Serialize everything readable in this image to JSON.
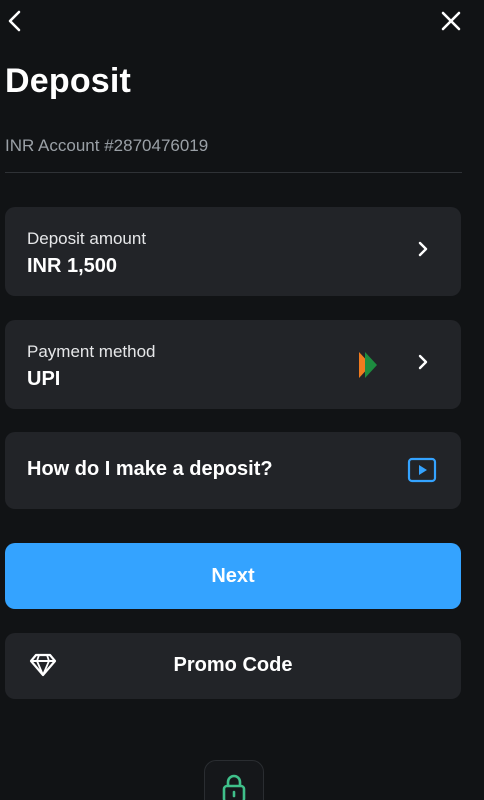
{
  "header": {
    "title": "Deposit",
    "back_icon": "back-arrow-icon",
    "close_icon": "close-icon"
  },
  "account": {
    "label": "INR Account #2870476019"
  },
  "deposit_amount": {
    "label": "Deposit amount",
    "value": "INR 1,500"
  },
  "payment_method": {
    "label": "Payment method",
    "value": "UPI",
    "logo": "upi-logo-icon"
  },
  "help": {
    "label": "How do I make a deposit?",
    "icon": "video-play-icon"
  },
  "next_button": {
    "label": "Next",
    "color": "#34a3ff"
  },
  "promo_button": {
    "label": "Promo Code",
    "icon": "diamond-icon"
  },
  "colors": {
    "background": "#111315",
    "card": "#222428",
    "accent": "#34a3ff"
  }
}
